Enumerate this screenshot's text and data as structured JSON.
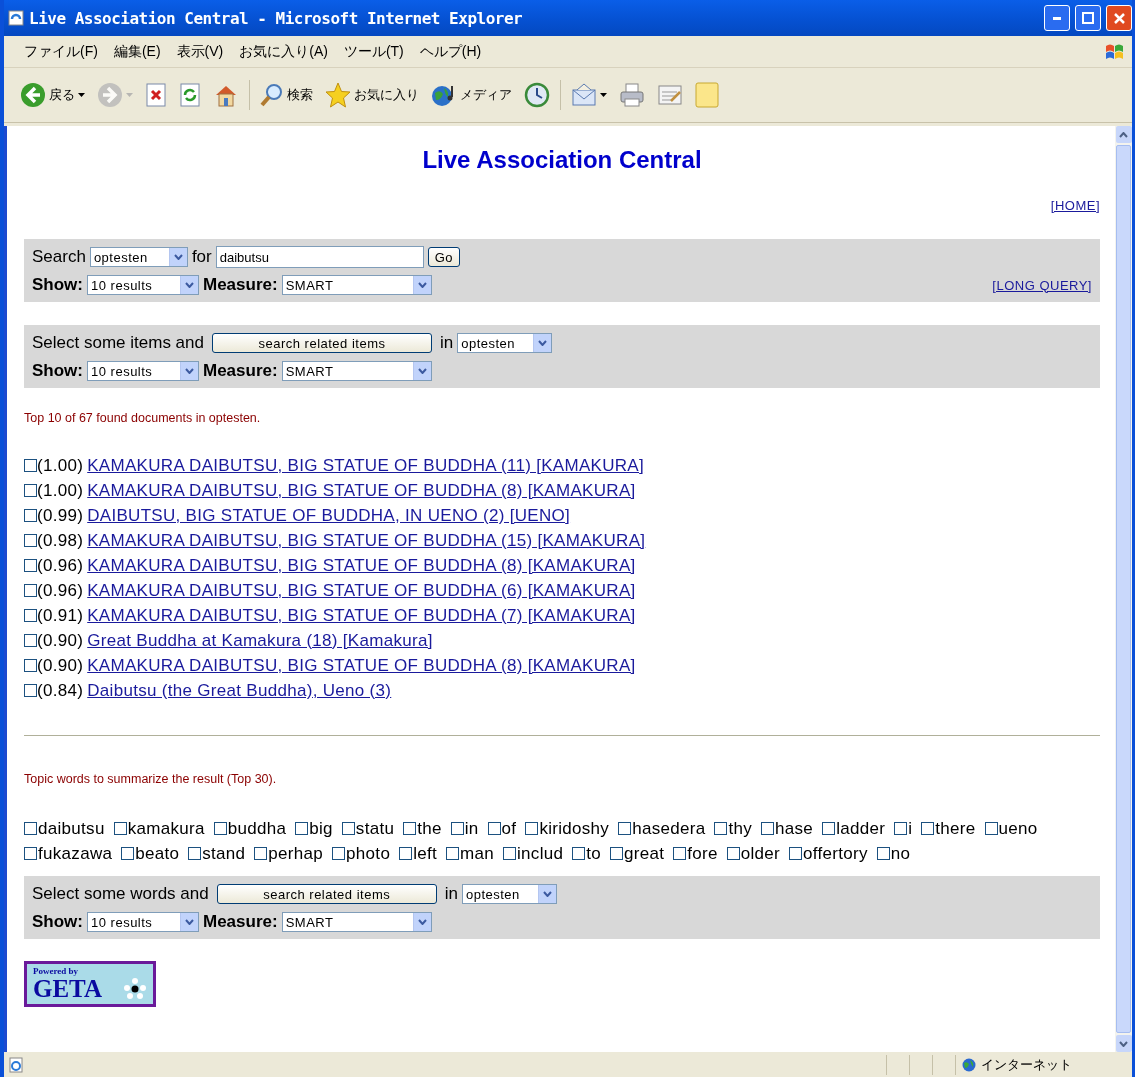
{
  "window": {
    "title": "Live Association Central - Microsoft Internet Explorer"
  },
  "menu": [
    "ファイル(F)",
    "編集(E)",
    "表示(V)",
    "お気に入り(A)",
    "ツール(T)",
    "ヘルプ(H)"
  ],
  "toolbar": [
    {
      "kind": "back",
      "label": "戻る",
      "dropdown": true,
      "disabled": false
    },
    {
      "kind": "forward",
      "dropdown": true,
      "disabled": true
    },
    {
      "kind": "stop",
      "dropdown": false,
      "disabled": false
    },
    {
      "kind": "refresh",
      "dropdown": false,
      "disabled": false
    },
    {
      "kind": "home",
      "dropdown": false,
      "disabled": false
    },
    {
      "kind": "search",
      "label": "検索",
      "dropdown": false,
      "disabled": false
    },
    {
      "kind": "favorites",
      "label": "お気に入り",
      "dropdown": false,
      "disabled": false
    },
    {
      "kind": "media",
      "label": "メディア",
      "dropdown": false,
      "disabled": false
    },
    {
      "kind": "history",
      "dropdown": false,
      "disabled": false
    },
    {
      "kind": "mail",
      "dropdown": true,
      "disabled": false
    },
    {
      "kind": "print",
      "dropdown": false,
      "disabled": false
    },
    {
      "kind": "edit",
      "dropdown": false,
      "disabled": false
    },
    {
      "kind": "note",
      "dropdown": false,
      "disabled": false
    }
  ],
  "page": {
    "title": "Live Association Central",
    "home_link": "[HOME]",
    "search_form": {
      "label": "Search",
      "collection": "optesten",
      "for_label": "for",
      "query": "daibutsu",
      "go": "Go",
      "show_label": "Show:",
      "show": "10 results",
      "measure_label": "Measure:",
      "measure": "SMART",
      "long_query": "[LONG QUERY]"
    },
    "items_form": {
      "label": "Select some items and",
      "button": "search related items",
      "in_label": "in",
      "collection": "optesten",
      "show_label": "Show:",
      "show": "10 results",
      "measure_label": "Measure:",
      "measure": "SMART"
    },
    "results_summary": "Top 10 of 67 found documents in optesten.",
    "results": [
      {
        "checked": false,
        "score": "(1.00)",
        "title": "KAMAKURA DAIBUTSU, BIG STATUE OF BUDDHA (11) [KAMAKURA]"
      },
      {
        "checked": false,
        "score": "(1.00)",
        "title": "KAMAKURA DAIBUTSU, BIG STATUE OF BUDDHA (8) [KAMAKURA]"
      },
      {
        "checked": false,
        "score": "(0.99)",
        "title": "DAIBUTSU, BIG STATUE OF BUDDHA, IN UENO (2) [UENO]"
      },
      {
        "checked": false,
        "score": "(0.98)",
        "title": "KAMAKURA DAIBUTSU, BIG STATUE OF BUDDHA (15) [KAMAKURA]"
      },
      {
        "checked": false,
        "score": "(0.96)",
        "title": "KAMAKURA DAIBUTSU, BIG STATUE OF BUDDHA (8) [KAMAKURA]"
      },
      {
        "checked": false,
        "score": "(0.96)",
        "title": "KAMAKURA DAIBUTSU, BIG STATUE OF BUDDHA (6) [KAMAKURA]"
      },
      {
        "checked": false,
        "score": "(0.91)",
        "title": "KAMAKURA DAIBUTSU, BIG STATUE OF BUDDHA (7) [KAMAKURA]"
      },
      {
        "checked": false,
        "score": "(0.90)",
        "title": "Great Buddha at Kamakura (18) [Kamakura]"
      },
      {
        "checked": false,
        "score": "(0.90)",
        "title": "KAMAKURA DAIBUTSU, BIG STATUE OF BUDDHA (8) [KAMAKURA]"
      },
      {
        "checked": false,
        "score": "(0.84)",
        "title": "Daibutsu (the Great Buddha), Ueno (3)"
      }
    ],
    "topic_summary": "Topic words to summarize the result (Top 30).",
    "topic_words": [
      {
        "word": "daibutsu",
        "checked": false
      },
      {
        "word": "kamakura",
        "checked": false
      },
      {
        "word": "buddha",
        "checked": false
      },
      {
        "word": "big",
        "checked": false
      },
      {
        "word": "statu",
        "checked": false
      },
      {
        "word": "the",
        "checked": false
      },
      {
        "word": "in",
        "checked": false
      },
      {
        "word": "of",
        "checked": false
      },
      {
        "word": "kiridoshy",
        "checked": false
      },
      {
        "word": "hasedera",
        "checked": false
      },
      {
        "word": "thy",
        "checked": false
      },
      {
        "word": "hase",
        "checked": false
      },
      {
        "word": "ladder",
        "checked": false
      },
      {
        "word": "i",
        "checked": false
      },
      {
        "word": "there",
        "checked": false
      },
      {
        "word": "ueno",
        "checked": false
      },
      {
        "word": "fukazawa",
        "checked": false
      },
      {
        "word": "beato",
        "checked": false
      },
      {
        "word": "stand",
        "checked": false
      },
      {
        "word": "perhap",
        "checked": false
      },
      {
        "word": "photo",
        "checked": false
      },
      {
        "word": "left",
        "checked": false
      },
      {
        "word": "man",
        "checked": false
      },
      {
        "word": "includ",
        "checked": false
      },
      {
        "word": "to",
        "checked": false
      },
      {
        "word": "great",
        "checked": false
      },
      {
        "word": "fore",
        "checked": false
      },
      {
        "word": "older",
        "checked": false
      },
      {
        "word": "offertory",
        "checked": false
      },
      {
        "word": "no",
        "checked": false
      }
    ],
    "words_form": {
      "label": "Select some words and",
      "button": "search related items",
      "in_label": "in",
      "collection": "optesten",
      "show_label": "Show:",
      "show": "10 results",
      "measure_label": "Measure:",
      "measure": "SMART"
    },
    "logo": {
      "tagline": "Powered by",
      "name": "GETA"
    }
  },
  "status_bar": {
    "zone": "インターネット"
  }
}
